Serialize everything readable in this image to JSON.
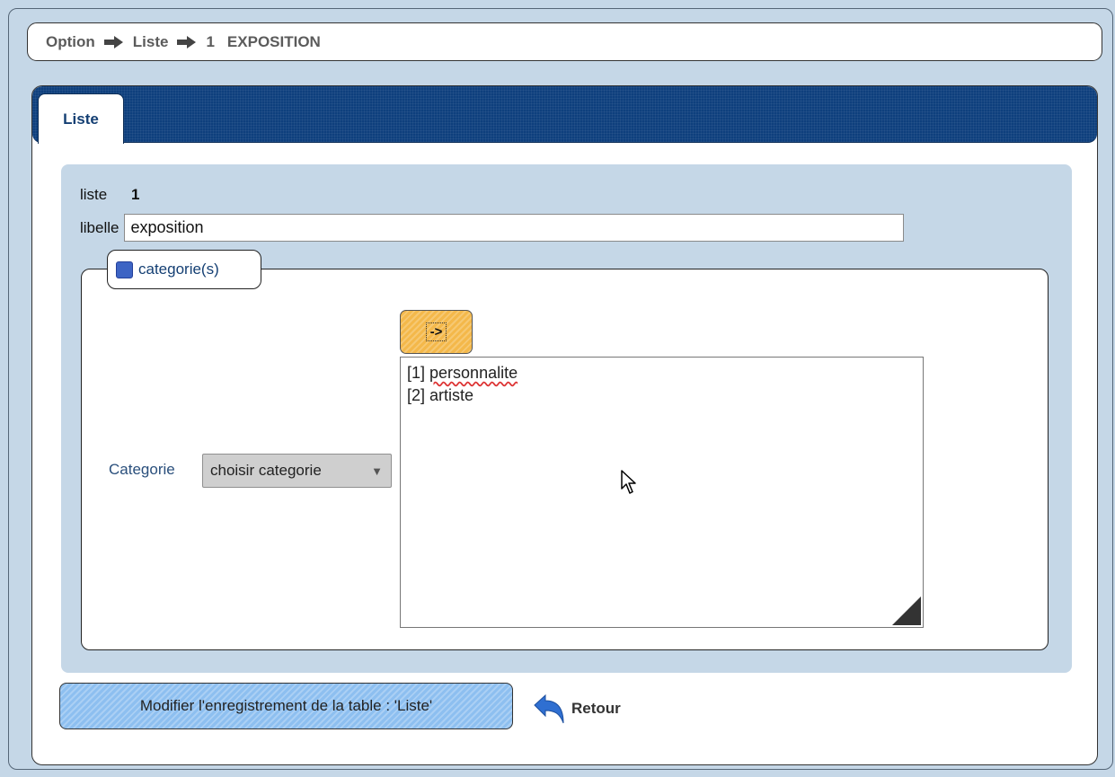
{
  "breadcrumb": {
    "item1": "Option",
    "item2": "Liste",
    "item3_num": "1",
    "item3_text": "EXPOSITION"
  },
  "tabs": [
    {
      "label": "Liste"
    }
  ],
  "form": {
    "liste_label": "liste",
    "liste_value": "1",
    "libelle_label": "libelle",
    "libelle_value": "exposition",
    "fieldset_title": "categorie(s)",
    "categorie_label": "Categorie",
    "categorie_select": "choisir categorie",
    "add_button": "->",
    "listbox_items": [
      {
        "id": "[1]",
        "text": "personnalite"
      },
      {
        "id": "[2]",
        "text": "artiste"
      }
    ]
  },
  "actions": {
    "submit_label": "Modifier l'enregistrement de la table : 'Liste'",
    "back_label": "Retour"
  },
  "colors": {
    "tabbar": "#0e3f7d",
    "background": "#c5d7e7",
    "submit": "#8dbff0",
    "arrow_button": "#f4b84a"
  },
  "icons": {
    "breadcrumb_separator": "arrow-right-icon",
    "back": "back-arrow-icon",
    "fieldset": "square-icon"
  }
}
